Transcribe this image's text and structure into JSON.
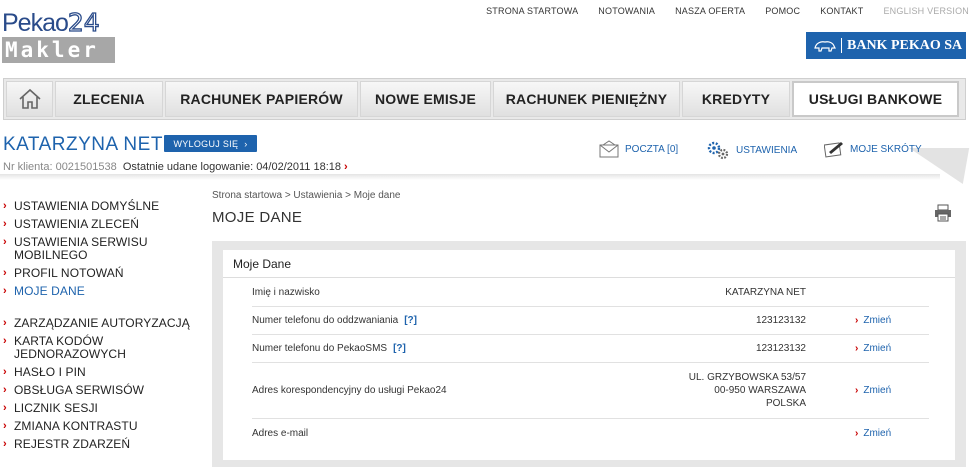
{
  "logo": {
    "brand": "Pekao",
    "number": "24",
    "sub": "Makler"
  },
  "topnav": [
    "STRONA STARTOWA",
    "NOTOWANIA",
    "NASZA OFERTA",
    "POMOC",
    "KONTAKT",
    "ENGLISH VERSION"
  ],
  "bank_badge": "BANK PEKAO SA",
  "mainmenu": [
    {
      "label": "ZLECENIA"
    },
    {
      "label": "RACHUNEK PAPIERÓW"
    },
    {
      "label": "NOWE EMISJE"
    },
    {
      "label": "RACHUNEK PIENIĘŻNY"
    },
    {
      "label": "KREDYTY"
    },
    {
      "label": "USŁUGI BANKOWE"
    }
  ],
  "user": {
    "name": "KATARZYNA NET",
    "logout": "WYLOGUJ SIĘ",
    "client_label": "Nr klienta: 0021501538",
    "last_login": "Ostatnie udane logowanie: 04/02/2011 18:18"
  },
  "quick": {
    "mail": "POCZTA [0]",
    "settings": "USTAWIENIA",
    "shortcuts": "MOJE SKRÓTY"
  },
  "sidebar": {
    "group1": [
      "USTAWIENIA DOMYŚLNE",
      "USTAWIENIA ZLECEŃ",
      "USTAWIENIA SERWISU MOBILNEGO",
      "PROFIL NOTOWAŃ",
      "MOJE DANE"
    ],
    "group2": [
      "ZARZĄDZANIE AUTORYZACJĄ",
      "KARTA KODÓW JEDNORAZOWYCH",
      "HASŁO I PIN",
      "OBSŁUGA SERWISÓW",
      "LICZNIK SESJI",
      "ZMIANA KONTRASTU",
      "REJESTR ZDARZEŃ"
    ]
  },
  "breadcrumb": "Strona startowa > Ustawienia > Moje dane",
  "page_title": "MOJE DANE",
  "panel": {
    "title": "Moje Dane",
    "rows": [
      {
        "label": "Imię i nazwisko",
        "help": "",
        "value": [
          "KATARZYNA NET"
        ],
        "action": ""
      },
      {
        "label": "Numer telefonu do oddzwaniania",
        "help": "[?]",
        "value": [
          "123123132"
        ],
        "action": "Zmień"
      },
      {
        "label": "Numer telefonu do PekaoSMS",
        "help": "[?]",
        "value": [
          "123123132"
        ],
        "action": "Zmień"
      },
      {
        "label": "Adres korespondencyjny do usługi Pekao24",
        "help": "",
        "value": [
          "UL. GRZYBOWSKA 53/57",
          "00-950 WARSZAWA",
          "POLSKA"
        ],
        "action": "Zmień"
      },
      {
        "label": "Adres e-mail",
        "help": "",
        "value": [
          ""
        ],
        "action": "Zmień"
      }
    ]
  },
  "colors": {
    "accent": "#1e63ad",
    "bullet": "#c80000",
    "logo_gray": "#a7a7a7"
  }
}
